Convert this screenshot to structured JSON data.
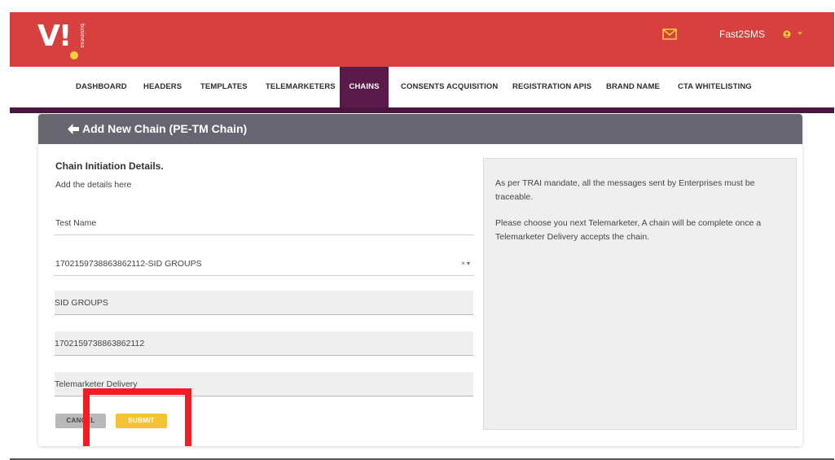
{
  "brand": {
    "logo_text": "V!",
    "logo_subtext": "business"
  },
  "header": {
    "username": "Fast2SMS"
  },
  "nav": [
    {
      "label": "DASHBOARD"
    },
    {
      "label": "HEADERS"
    },
    {
      "label": "TEMPLATES"
    },
    {
      "label": "TELEMARKETERS"
    },
    {
      "label": "CHAINS",
      "active": true
    },
    {
      "label": "CONSENTS ACQUISITION"
    },
    {
      "label": "REGISTRATION APIS"
    },
    {
      "label": "BRAND NAME"
    },
    {
      "label": "CTA WHITELISTING"
    }
  ],
  "page": {
    "title": "Add New Chain (PE-TM Chain)",
    "section_title": "Chain Initiation Details.",
    "section_subtitle": "Add the details here"
  },
  "form": {
    "name_value": "Test Name",
    "entity_select_value": "1702159738863862112-SID GROUPS",
    "select_controls": "× ▾",
    "entity_name_value": "SID GROUPS",
    "entity_id_value": "1702159738863862112",
    "next_tm_value": "Telemarketer Delivery"
  },
  "buttons": {
    "cancel": "CANCEL",
    "submit": "SUBMIT"
  },
  "info": {
    "paragraph1": "As per TRAI mandate, all the messages sent by Enterprises must be traceable.",
    "paragraph2": "Please choose you next Telemarketer, A chain will be complete once a Telemarketer Delivery accepts the chain."
  },
  "colors": {
    "topbar": "#d7403f",
    "nav_active": "#5a1a4a",
    "card_header": "#676570",
    "submit": "#f4c333",
    "highlight": "#f21c24"
  }
}
